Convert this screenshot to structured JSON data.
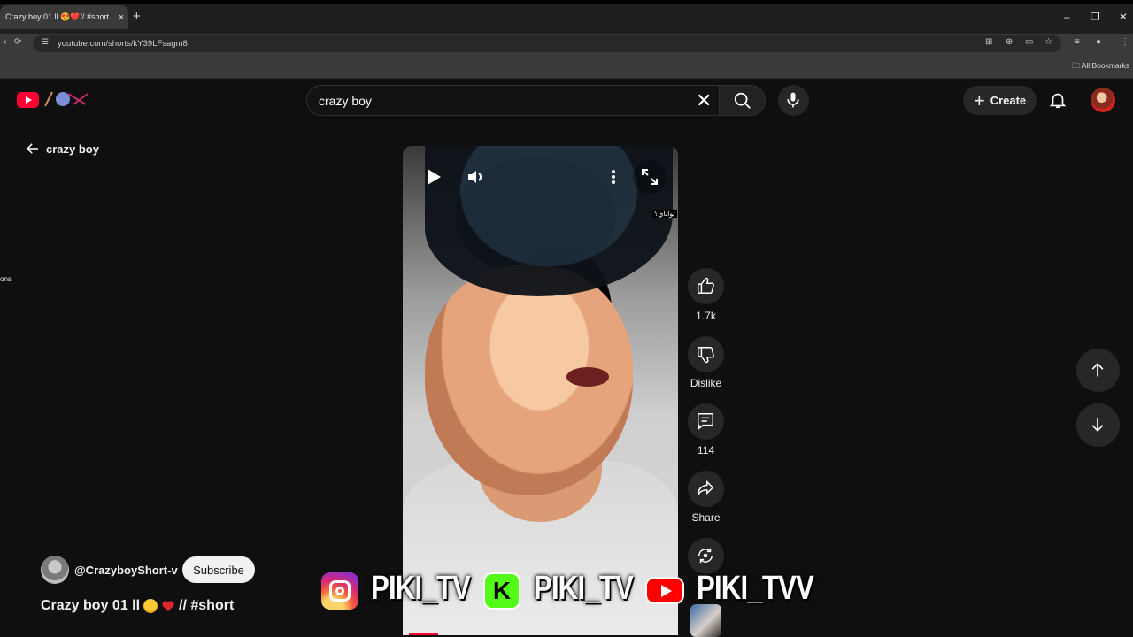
{
  "browser": {
    "tab_title": "Crazy boy 01 ll 😍❤️// #short",
    "tab_close": "×",
    "new_tab": "+",
    "url": "youtube.com/shorts/kY39LFsagm8",
    "bookmarks_label": "All Bookmarks",
    "window_controls": [
      "–",
      "❐",
      "✕"
    ]
  },
  "header": {
    "search_value": "crazy boy",
    "create_label": "Create"
  },
  "nav": {
    "back_label": "crazy boy",
    "left_partial_text": "ons"
  },
  "video": {
    "overlay_text": "تواناي؟",
    "watermark": {
      "items": [
        {
          "platform": "instagram-icon",
          "text": "PIKI_TV"
        },
        {
          "platform": "kick-icon",
          "letter": "K",
          "text": "PIKI_TV"
        },
        {
          "platform": "youtube-icon",
          "text": "PIKI_TVV"
        }
      ]
    },
    "progress_fraction": 0.1
  },
  "actions": {
    "like_count": "1.7k",
    "dislike_label": "Dislike",
    "comment_count": "114",
    "share_label": "Share"
  },
  "channel": {
    "handle": "@CrazyboyShort-v",
    "subscribe_label": "Subscribe"
  },
  "short": {
    "title_prefix": "Crazy boy 01 ll",
    "title_suffix": "// #short"
  },
  "colors": {
    "background": "#0f0f0f",
    "brand_red": "#ff0033",
    "surface": "#272727",
    "text": "#f1f1f1"
  }
}
